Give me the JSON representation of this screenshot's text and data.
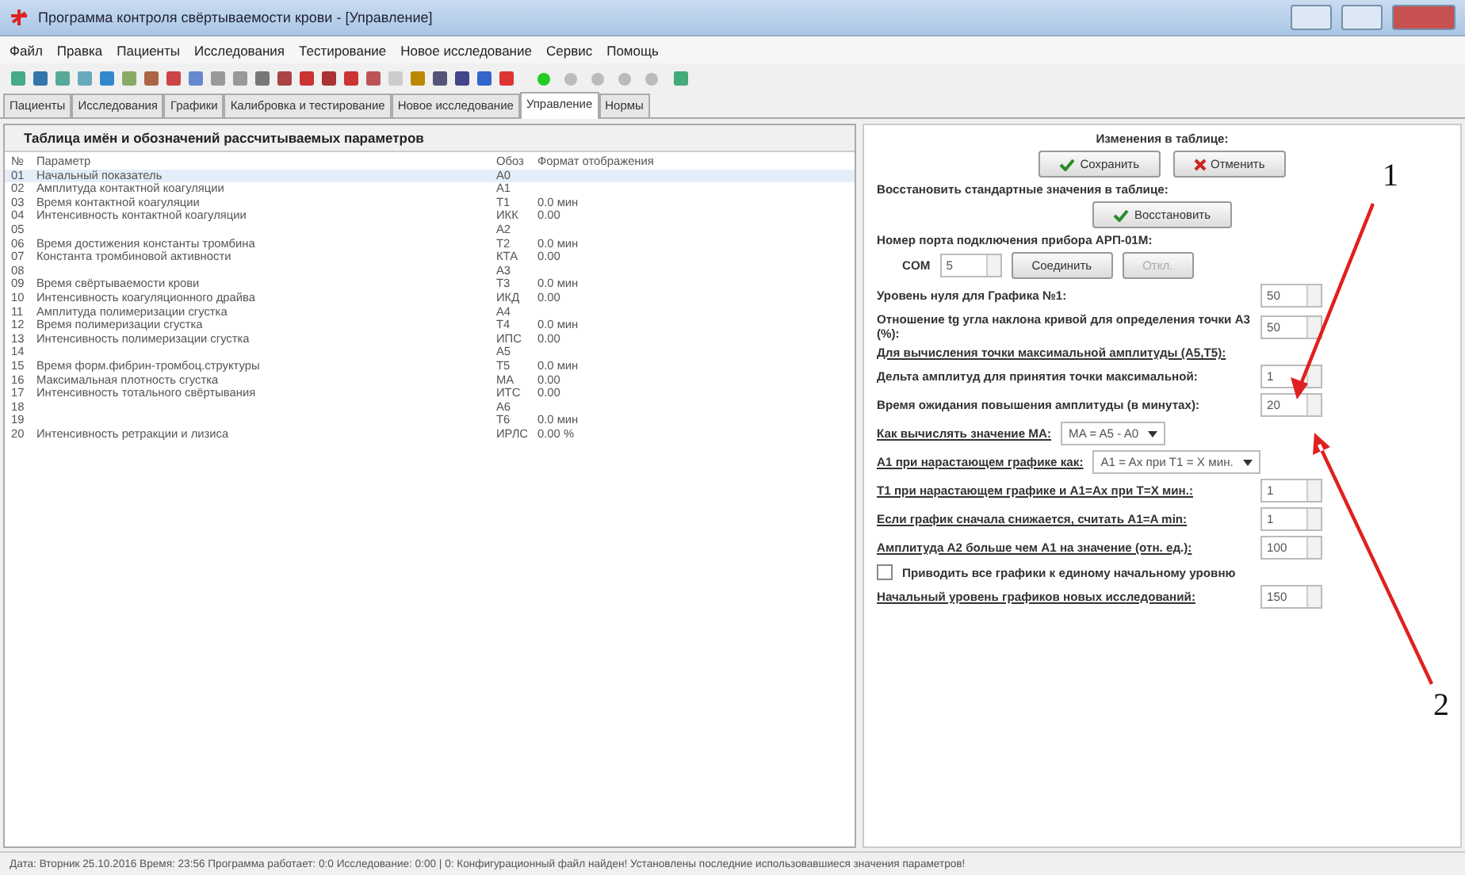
{
  "window": {
    "title": "Программа контроля свёртываемости крови - [Управление]"
  },
  "menu": [
    "Файл",
    "Правка",
    "Пациенты",
    "Исследования",
    "Тестирование",
    "Новое исследование",
    "Сервис",
    "Помощь"
  ],
  "tabs": [
    {
      "label": "Пациенты",
      "selected": false
    },
    {
      "label": "Исследования",
      "selected": false
    },
    {
      "label": "Графики",
      "selected": false
    },
    {
      "label": "Калибровка и тестирование",
      "selected": false
    },
    {
      "label": "Новое исследование",
      "selected": false
    },
    {
      "label": "Управление",
      "selected": true
    },
    {
      "label": "Нормы",
      "selected": false
    }
  ],
  "table": {
    "title": "Таблица имён и обозначений рассчитываемых параметров",
    "columns": [
      "№",
      "Параметр",
      "Обоз",
      "Формат отображения"
    ],
    "rows": [
      {
        "n": "01",
        "name": "Начальный показатель",
        "code": "A0",
        "format": "",
        "selected": true
      },
      {
        "n": "02",
        "name": "Амплитуда контактной коагуляции",
        "code": "A1",
        "format": "",
        "selected": false
      },
      {
        "n": "03",
        "name": "Время контактной коагуляции",
        "code": "T1",
        "format": "0.0 мин",
        "selected": false
      },
      {
        "n": "04",
        "name": "Интенсивность контактной коагуляции",
        "code": "ИКК",
        "format": "0.00",
        "selected": false
      },
      {
        "n": "05",
        "name": "",
        "code": "A2",
        "format": "",
        "selected": false
      },
      {
        "n": "06",
        "name": "Время достижения константы тромбина",
        "code": "T2",
        "format": "0.0 мин",
        "selected": false
      },
      {
        "n": "07",
        "name": "Константа тромбиновой активности",
        "code": "КТА",
        "format": "0.00",
        "selected": false
      },
      {
        "n": "08",
        "name": "",
        "code": "A3",
        "format": "",
        "selected": false
      },
      {
        "n": "09",
        "name": "Время свёртываемости крови",
        "code": "T3",
        "format": "0.0 мин",
        "selected": false
      },
      {
        "n": "10",
        "name": "Интенсивность коагуляционного драйва",
        "code": "ИКД",
        "format": "0.00",
        "selected": false
      },
      {
        "n": "11",
        "name": "Амплитуда полимеризации сгустка",
        "code": "A4",
        "format": "",
        "selected": false
      },
      {
        "n": "12",
        "name": "Время полимеризации сгустка",
        "code": "T4",
        "format": "0.0 мин",
        "selected": false
      },
      {
        "n": "13",
        "name": "Интенсивность полимеризации сгустка",
        "code": "ИПС",
        "format": "0.00",
        "selected": false
      },
      {
        "n": "14",
        "name": "",
        "code": "A5",
        "format": "",
        "selected": false
      },
      {
        "n": "15",
        "name": "Время форм.фибрин-тромбоц.структуры",
        "code": "T5",
        "format": "0.0 мин",
        "selected": false
      },
      {
        "n": "16",
        "name": "Максимальная плотность сгустка",
        "code": "MA",
        "format": "0.00",
        "selected": false
      },
      {
        "n": "17",
        "name": "Интенсивность тотального свёртывания",
        "code": "ИТС",
        "format": "0.00",
        "selected": false
      },
      {
        "n": "18",
        "name": "",
        "code": "A6",
        "format": "",
        "selected": false
      },
      {
        "n": "19",
        "name": "",
        "code": "T6",
        "format": "0.0 мин",
        "selected": false
      },
      {
        "n": "20",
        "name": "Интенсивность ретракции и лизиса",
        "code": "ИРЛС",
        "format": "0.00 %",
        "selected": false
      }
    ]
  },
  "settings": [
    {
      "kind": "caption",
      "text": "Изменения в таблице:"
    },
    {
      "kind": "buttons",
      "buttons": [
        {
          "label": "Сохранить",
          "kind": "ok",
          "disabled": false
        },
        {
          "label": "Отменить",
          "kind": "cancel",
          "disabled": false
        }
      ]
    },
    {
      "kind": "label",
      "text": "Восстановить стандартные значения в таблице:"
    },
    {
      "kind": "buttons",
      "buttons": [
        {
          "label": "Восстановить",
          "kind": "ok",
          "disabled": false
        }
      ]
    },
    {
      "kind": "label",
      "text": "Номер порта подключения прибора АРП-01М:"
    },
    {
      "kind": "port",
      "prefix": "COM",
      "value": "5",
      "buttons": [
        {
          "label": "Соединить",
          "kind": "plain",
          "disabled": false
        },
        {
          "label": "Откл.",
          "kind": "plain",
          "disabled": true
        }
      ]
    },
    {
      "kind": "spin",
      "label": "Уровень нуля для Графика №1:",
      "value": "50"
    },
    {
      "kind": "spin",
      "label": "Отношение tg угла наклона кривой для определения точки А3 (%):",
      "value": "50"
    },
    {
      "kind": "section",
      "text": "Для вычисления точки максимальной амплитуды (A5,T5):"
    },
    {
      "kind": "spin",
      "label": "Дельта амплитуд для принятия точки максимальной:",
      "value": "1"
    },
    {
      "kind": "spin",
      "label": "Время ожидания повышения амплитуды (в минутах):",
      "value": "20"
    },
    {
      "kind": "dropdown",
      "label": "Как вычислять значение MA:",
      "value": "MA = A5 - A0"
    },
    {
      "kind": "dropdown",
      "label": "A1 при нарастающем графике как:",
      "value": "A1 = Ax при T1 = X мин."
    },
    {
      "kind": "spin",
      "label": "T1 при нарастающем графике и A1=Ax при T=X мин.:",
      "value": "1",
      "underline": true
    },
    {
      "kind": "spin",
      "label": "Если график сначала снижается, считать A1=A min:",
      "value": "1",
      "underline": true
    },
    {
      "kind": "spin",
      "label": "Амплитуда A2 больше чем A1 на значение (отн. ед.):",
      "value": "100",
      "underline": true
    },
    {
      "kind": "checkbox",
      "label": "Приводить все графики к единому начальному уровню",
      "checked": false
    },
    {
      "kind": "spin",
      "label": "Начальный уровень графиков новых исследований:",
      "value": "150",
      "underline": true
    }
  ],
  "annotations": [
    "1",
    "2"
  ],
  "status_bar": "Дата: Вторник 25.10.2016 Время: 23:56 Программа работает: 0:0 Исследование: 0:00 | 0: Конфигурационный файл найден! Установлены последние использовавшиеся значения параметров!"
}
